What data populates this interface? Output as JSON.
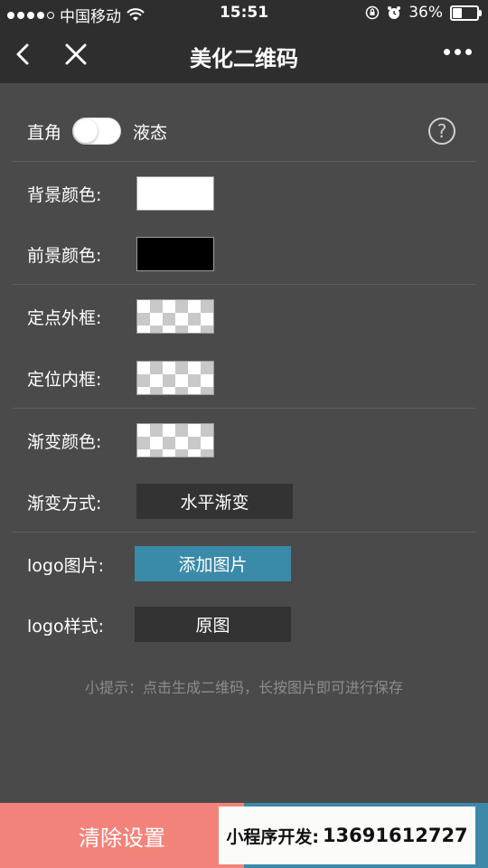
{
  "status": {
    "carrier": "中国移动",
    "time": "15:51",
    "battery": "36%",
    "battery_level": 0.36
  },
  "nav": {
    "title": "美化二维码"
  },
  "mode": {
    "left_label": "直角",
    "right_label": "液态",
    "help_symbol": "?"
  },
  "settings": {
    "bg_color_label": "背景颜色:",
    "bg_color_value": "#ffffff",
    "fg_color_label": "前景颜色:",
    "fg_color_value": "#000000",
    "position_outer_label": "定点外框:",
    "position_inner_label": "定位内框:",
    "gradient_color_label": "渐变颜色:",
    "gradient_mode_label": "渐变方式:",
    "gradient_mode_value": "水平渐变",
    "logo_image_label": "logo图片:",
    "logo_image_button": "添加图片",
    "logo_style_label": "logo样式:",
    "logo_style_value": "原图"
  },
  "tip": "小提示：点击生成二维码，长按图片即可进行保存",
  "footer": {
    "clear_label": "清除设置",
    "promo_label": "小程序开发:",
    "promo_number": "13691612727"
  },
  "colors": {
    "background": "#4a4a4a",
    "bar": "#2e2e2e",
    "accent_blue": "#3a8aaa",
    "clear_red": "#f3837a"
  }
}
